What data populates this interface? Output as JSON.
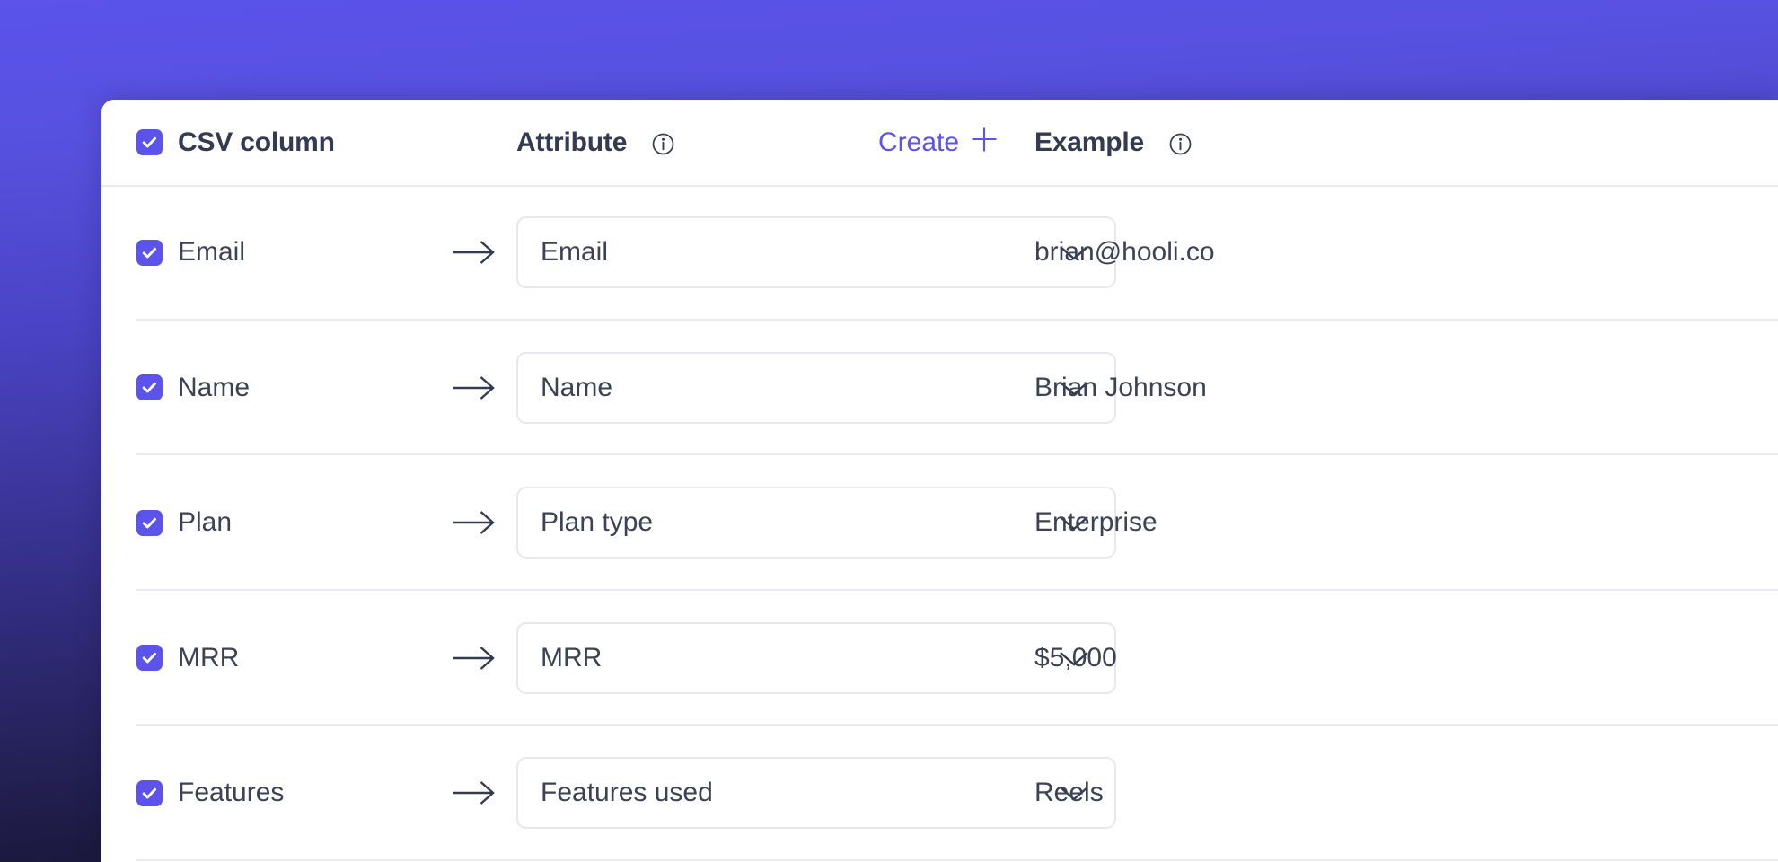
{
  "theme": {
    "accent": "#5b53ea",
    "text": "#3a4254",
    "heading": "#323b51",
    "divider": "#e8eaef",
    "select_border": "#e6e8ee",
    "card_bg": "#ffffff",
    "backdrop_top": "#5b53ea",
    "backdrop_bottom": "#121029"
  },
  "header": {
    "select_all_checked": true,
    "csv_column_label": "CSV column",
    "attribute_label": "Attribute",
    "attribute_info_icon": "info-icon",
    "create_label": "Create",
    "create_plus_icon": "plus-icon",
    "example_label": "Example",
    "example_info_icon": "info-icon",
    "select_all_icon": "checkbox-checked-icon"
  },
  "rows": [
    {
      "checked": true,
      "csv_column": "Email",
      "arrow_icon": "arrow-right-icon",
      "attribute": "Email",
      "chevron_icon": "chevron-down-icon",
      "example": "brian@hooli.co"
    },
    {
      "checked": true,
      "csv_column": "Name",
      "arrow_icon": "arrow-right-icon",
      "attribute": "Name",
      "chevron_icon": "chevron-down-icon",
      "example": "Brian Johnson"
    },
    {
      "checked": true,
      "csv_column": "Plan",
      "arrow_icon": "arrow-right-icon",
      "attribute": "Plan type",
      "chevron_icon": "chevron-down-icon",
      "example": "Enterprise"
    },
    {
      "checked": true,
      "csv_column": "MRR",
      "arrow_icon": "arrow-right-icon",
      "attribute": "MRR",
      "chevron_icon": "chevron-down-icon",
      "example": "$5,000"
    },
    {
      "checked": true,
      "csv_column": "Features",
      "arrow_icon": "arrow-right-icon",
      "attribute": "Features used",
      "chevron_icon": "chevron-down-icon",
      "example": "Reels"
    }
  ]
}
